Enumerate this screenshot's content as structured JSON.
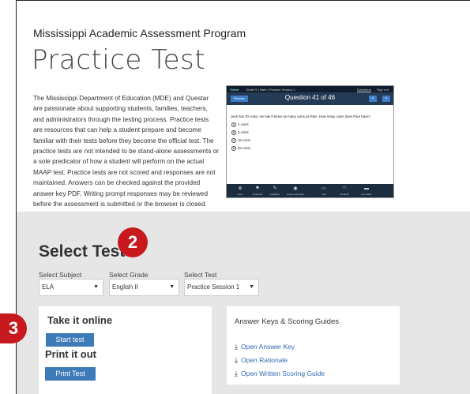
{
  "header": {
    "program": "Mississippi Academic Assessment Program",
    "title": "Practice Test"
  },
  "intro": "The Mississippi Department of Education (MDE) and Questar are passionate about supporting students, families, teachers, and administrators through the testing process. Practice tests are resources that can help a student prepare and become familiar with their tests before they become the official test. The practice tests are not intended to be stand-alone assessments or a sole predicator of how a student will perform on the actual MAAP test. Practice tests are not scored and responses are not maintained. Answers can be checked against the provided answer key PDF. Writing prompt responses may be reviewed before the assessment is submitted or the browser is closed. Once the submit or sign out button is clicked, we are unable to recover individual responses.",
  "screenshot": {
    "logo": "Online",
    "breadcrumb": "Grade 5 | Math | Practice Session 1",
    "top_right_1": "Directions",
    "top_right_2": "Sign out",
    "review": "Review",
    "question": "Question 41 of 46",
    "prev": "<",
    "next": ">",
    "stem": "Jack has 20 coins. He has 5 times as many coins as Pam. How many coins does Pam have?",
    "options": [
      {
        "letter": "A",
        "text": "4 coins"
      },
      {
        "letter": "B",
        "text": "5 coins"
      },
      {
        "letter": "C",
        "text": "15 coins"
      },
      {
        "letter": "D",
        "text": "25 coins"
      }
    ],
    "tools": [
      "zoom",
      "bookmark",
      "highlighter",
      "answer eliminator",
      "ruler",
      "protractor",
      "line reader"
    ]
  },
  "select": {
    "heading": "Select Test",
    "subject_label": "Select Subject",
    "subject_value": "ELA",
    "grade_label": "Select Grade",
    "grade_value": "English II",
    "test_label": "Select Test",
    "test_value": "Practice Session 1",
    "arrow": "▼"
  },
  "badges": {
    "two": "2",
    "three": "3"
  },
  "online": {
    "heading": "Take it online",
    "start_button": "Start test",
    "print_heading": "Print it out",
    "print_button": "Print Test"
  },
  "keys": {
    "heading": "Answer Keys & Scoring Guides",
    "links": [
      "Open Answer Key",
      "Open Rationale",
      "Open Written Scoring Guide"
    ]
  },
  "colors": {
    "accent": "#3d7ab8",
    "badge": "#c8191f",
    "gray_bg": "#e6e6e6",
    "link": "#2c6cb0"
  }
}
